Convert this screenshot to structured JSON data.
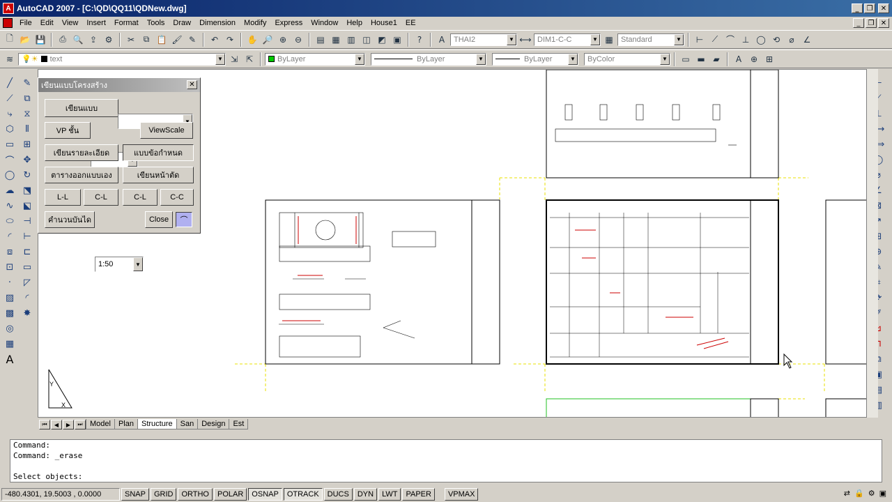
{
  "window": {
    "title": "AutoCAD 2007 - [C:\\QD\\QQ11\\QDNew.dwg]",
    "app_icon": "A"
  },
  "menu": [
    "File",
    "Edit",
    "View",
    "Insert",
    "Format",
    "Tools",
    "Draw",
    "Dimension",
    "Modify",
    "Express",
    "Window",
    "Help",
    "House1",
    "EE"
  ],
  "toolbar1": {
    "text_style": "THAI2",
    "dim_style": "DIM1-C-C",
    "table_style": "Standard"
  },
  "toolbar2": {
    "layer": "text",
    "color": "ByLayer",
    "linetype": "ByLayer",
    "lineweight": "ByLayer",
    "plotstyle": "ByColor"
  },
  "palette": {
    "title": "เขียนแบบโครงสร้าง",
    "draw_label": "เขียนแบบ",
    "draw_value": "",
    "vp_label": "VP ชั้น",
    "vp_value": "",
    "viewscale": "ViewScale",
    "detail": "เขียนรายละเอียด",
    "spec": "แบบข้อกำหนด",
    "schedule": "ตารางออกแบบเอง",
    "section": "เขียนหน้าตัด",
    "ll": "L-L",
    "cl1": "C-L",
    "cl2": "C-L",
    "cc": "C-C",
    "stair_label": "คำนวนบันได",
    "stair_value": "1:50",
    "close": "Close"
  },
  "layout_tabs": [
    "Model",
    "Plan",
    "Structure",
    "San",
    "Design",
    "Est"
  ],
  "active_tab": "Structure",
  "command": {
    "lines": [
      "Command:",
      "Command: _erase",
      ""
    ],
    "prompt": "Select objects:"
  },
  "status": {
    "coords": "-480.4301, 19.5003 , 0.0000",
    "buttons": [
      "SNAP",
      "GRID",
      "ORTHO",
      "POLAR",
      "OSNAP",
      "OTRACK",
      "DUCS",
      "DYN",
      "LWT",
      "PAPER"
    ],
    "on": [
      "OSNAP",
      "OTRACK"
    ],
    "vpmax": "VPMAX"
  }
}
